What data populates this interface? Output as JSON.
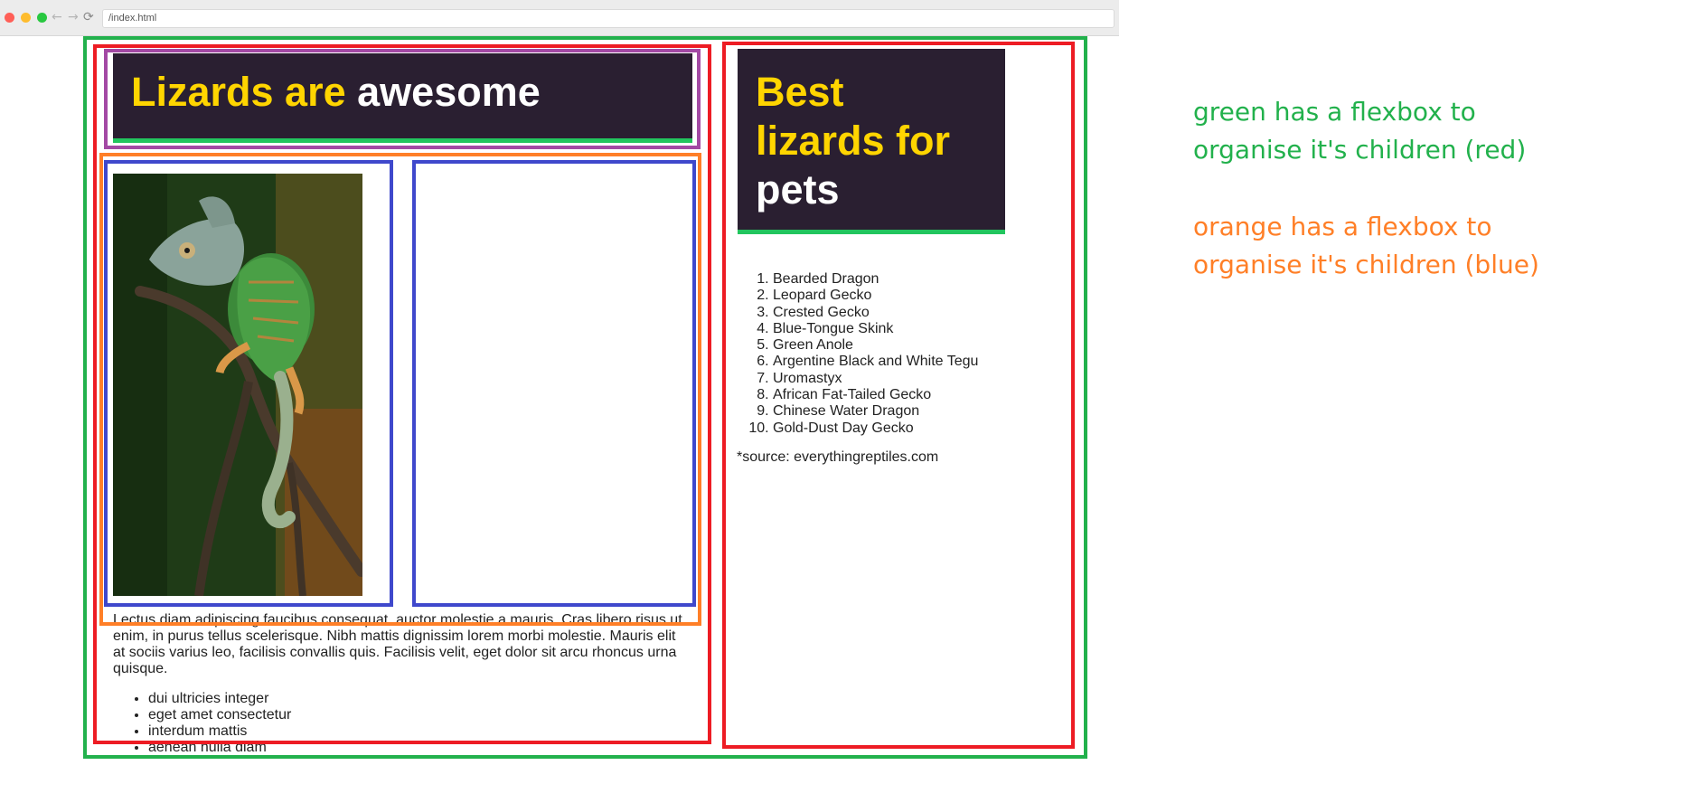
{
  "browser": {
    "url": "/index.html",
    "back_glyph": "←",
    "forward_glyph": "→",
    "reload_glyph": "⟳"
  },
  "main_header": {
    "title_part1": "Lizards are",
    "title_part2": "awesome"
  },
  "photo": {
    "subject": "chameleon on branch"
  },
  "article": {
    "paragraph": "Lectus diam adipiscing faucibus consequat, auctor molestie a mauris. Cras libero risus ut enim, in purus tellus scelerisque. Nibh mattis dignissim lorem morbi molestie. Mauris elit at sociis varius leo, facilisis convallis quis. Facilisis velit, eget dolor sit arcu rhoncus urna quisque.",
    "bullets": [
      "dui ultricies integer",
      "eget amet consectetur",
      "interdum mattis",
      "aenean nulla diam"
    ]
  },
  "sidebar": {
    "title_line1": "Best",
    "title_line2": "lizards for",
    "title_line3": "pets",
    "items": [
      "Bearded Dragon",
      "Leopard Gecko",
      "Crested Gecko",
      "Blue-Tongue Skink",
      "Green Anole",
      "Argentine Black and White Tegu",
      "Uromastyx",
      "African Fat-Tailed Gecko",
      "Chinese Water Dragon",
      "Gold-Dust Day Gecko"
    ],
    "source": "*source: everythingreptiles.com"
  },
  "annotations": {
    "green_line1": "green has a flexbox to",
    "green_line2": "organise it's children (red)",
    "orange_line1": "orange has a flexbox to",
    "orange_line2": "organise it's children (blue)"
  },
  "colors": {
    "green": "#22b14c",
    "red": "#ed1c24",
    "orange": "#ff7f27",
    "blue": "#3f48cc",
    "purple": "#a349a4",
    "header_bg": "#2a1f31",
    "heading_yellow": "#ffd500"
  }
}
